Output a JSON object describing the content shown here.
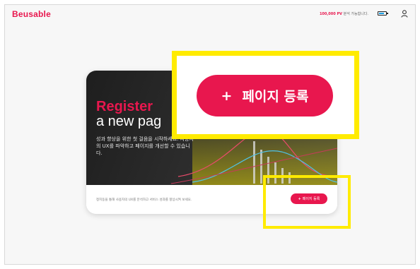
{
  "header": {
    "logo": "Beusable",
    "pv_amount": "100,000 PV",
    "pv_suffix": "분석 가능합니다.",
    "icons": [
      "battery-icon",
      "user-icon"
    ]
  },
  "card": {
    "title_line1": "Register",
    "title_line2": "a new pag",
    "description": "성과 향상을 위한 첫 걸음을 시작하세요. 사용자의 UX를 파악하고 페이지를 개선할 수 있습니다.",
    "footer_text": "정지동을 통해 사용자의 UX를 분석하고 서비스 성과를 향상시켜 보세요.",
    "register_button": {
      "plus": "+",
      "label": "페이지 등록"
    }
  },
  "zoom": {
    "register_button": {
      "plus": "+",
      "label": "페이지 등록"
    }
  },
  "colors": {
    "accent": "#e8174e",
    "highlight": "#ffeb00",
    "hero_bg": "#2a2a2a"
  }
}
